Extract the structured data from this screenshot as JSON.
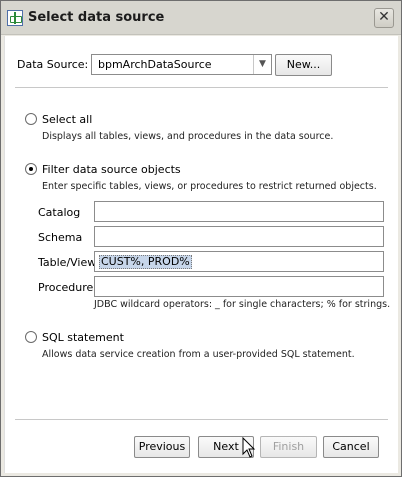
{
  "window": {
    "title": "Select data source",
    "close_icon": "close-icon"
  },
  "datasource": {
    "label": "Data Source:",
    "value": "bpmArchDataSource",
    "new_button": "New..."
  },
  "options": {
    "select_all": {
      "label": "Select all",
      "description": "Displays all tables, views, and procedures in the data source.",
      "checked": false
    },
    "filter": {
      "label": "Filter data source objects",
      "description": "Enter specific tables, views, or procedures to restrict returned objects.",
      "checked": true
    },
    "sql": {
      "label": "SQL statement",
      "description": "Allows data service creation from a user-provided SQL statement.",
      "checked": false
    }
  },
  "filter_fields": {
    "catalog": {
      "label": "Catalog",
      "value": ""
    },
    "schema": {
      "label": "Schema",
      "value": ""
    },
    "table_view": {
      "label": "Table/View",
      "value": "CUST%, PROD%"
    },
    "procedure": {
      "label": "Procedure",
      "value": ""
    },
    "hint": "JDBC wildcard operators: _ for single characters; % for strings."
  },
  "buttons": {
    "previous": "Previous",
    "next": "Next",
    "finish": "Finish",
    "cancel": "Cancel"
  }
}
